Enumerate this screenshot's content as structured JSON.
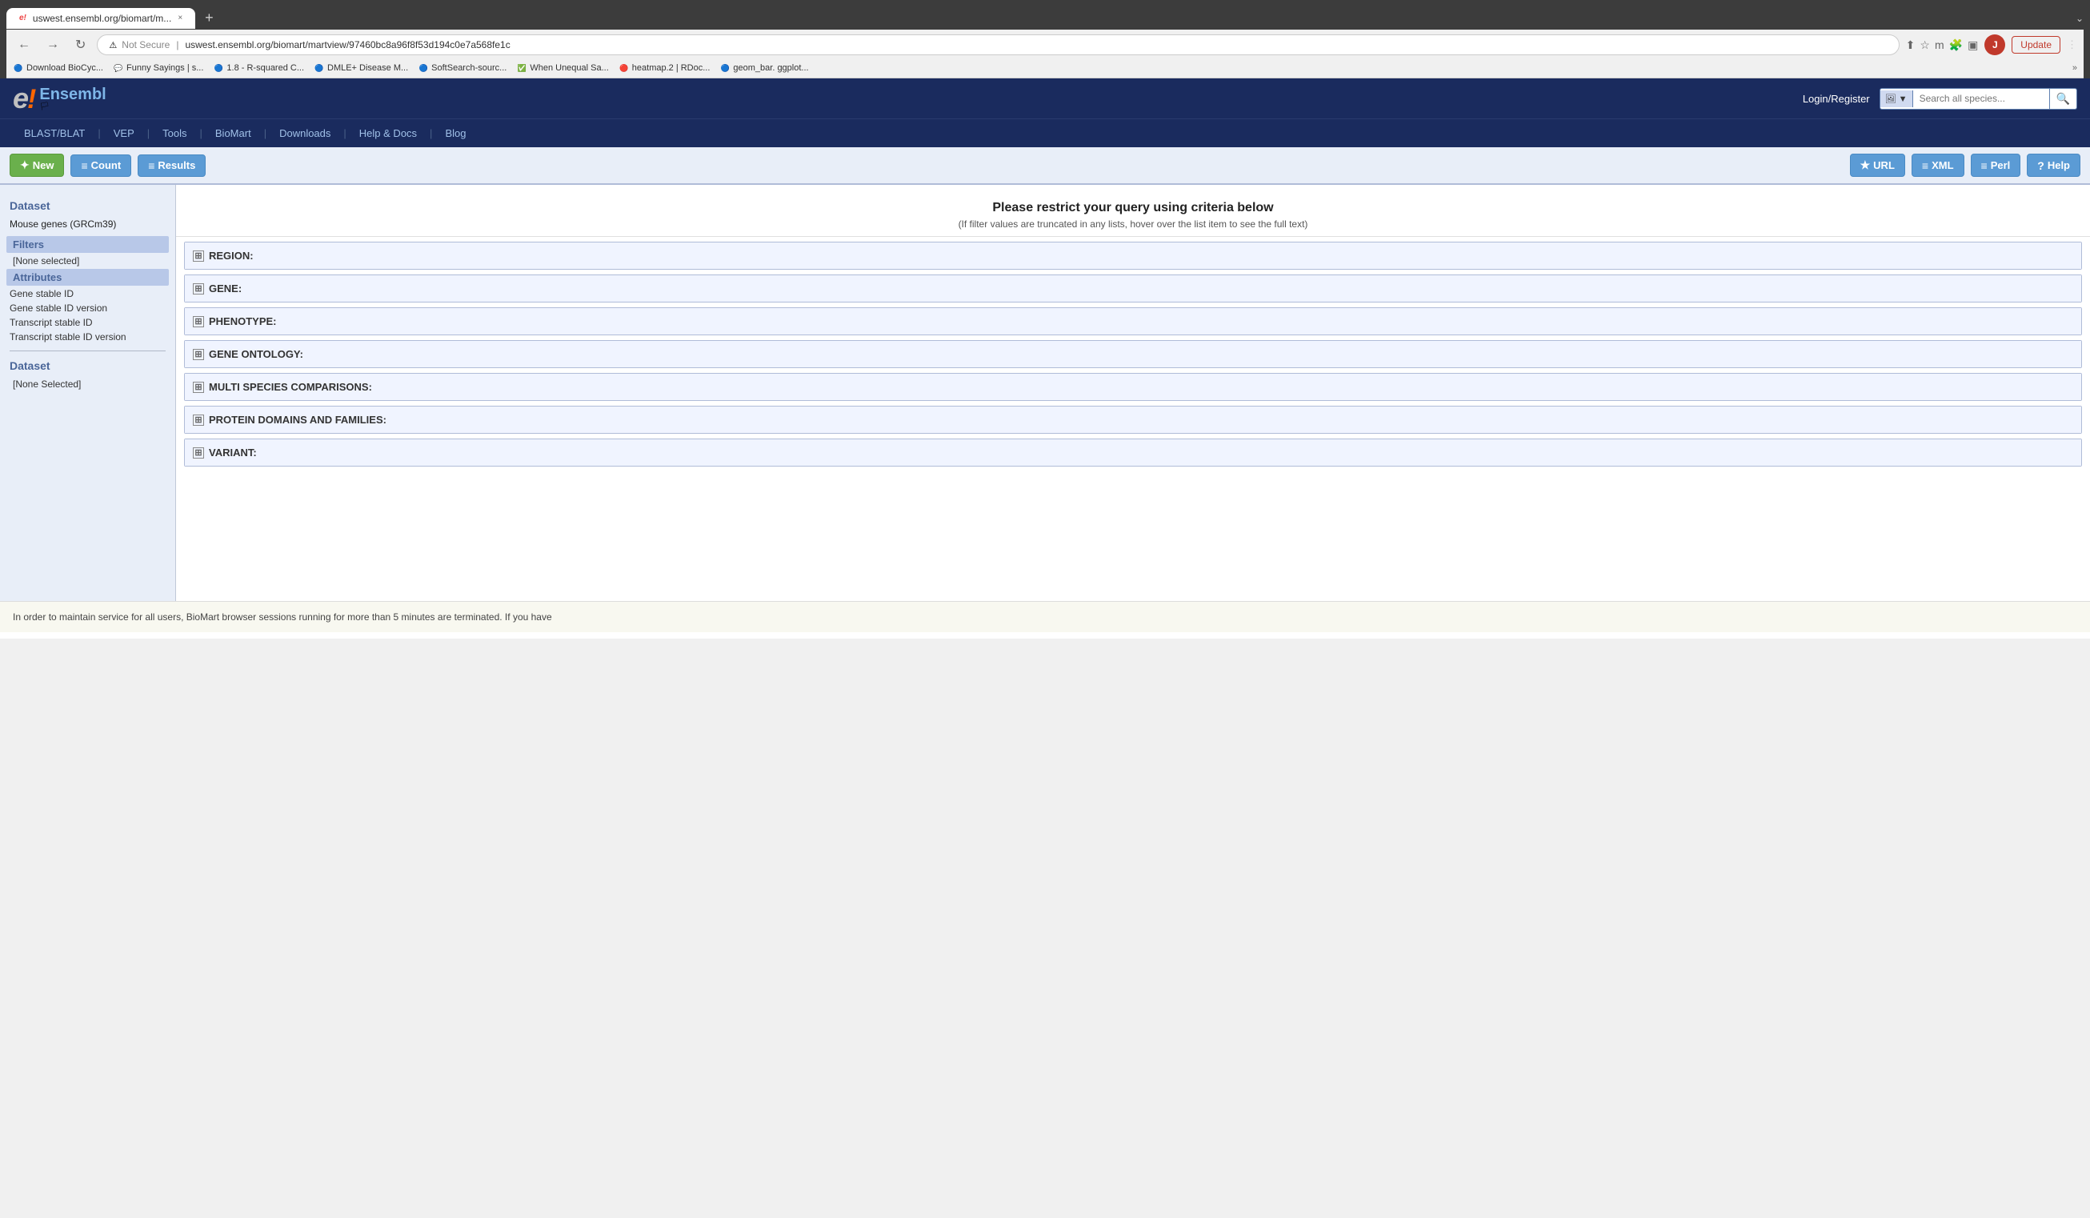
{
  "browser": {
    "tab": {
      "favicon": "e!",
      "title": "uswest.ensembl.org/biomart/m...",
      "close": "×"
    },
    "new_tab_icon": "+",
    "tab_end_icon": "⌄",
    "nav": {
      "back": "←",
      "forward": "→",
      "refresh": "↻"
    },
    "address": {
      "not_secure": "Not Secure",
      "url": "uswest.ensembl.org/biomart/martview/97460bc8a96f8f53d194c0e7a568fe1c"
    },
    "actions": {
      "share": "⬆",
      "star": "☆",
      "m_icon": "m",
      "puzzle": "🧩",
      "sidebar": "▣",
      "update_label": "Update",
      "menu": "⋮"
    },
    "bookmarks": [
      {
        "favicon": "🔵",
        "label": "Download BioCyc..."
      },
      {
        "favicon": "💬",
        "label": "Funny Sayings | s..."
      },
      {
        "favicon": "🔵",
        "label": "1.8 - R-squared C..."
      },
      {
        "favicon": "🔵",
        "label": "DMLE+ Disease M..."
      },
      {
        "favicon": "🔵",
        "label": "SoftSearch-sourc..."
      },
      {
        "favicon": "✅",
        "label": "When Unequal Sa..."
      },
      {
        "favicon": "🔴",
        "label": "heatmap.2 | RDoc..."
      },
      {
        "favicon": "🔵",
        "label": "geom_bar. ggplot..."
      },
      {
        "favicon": "»",
        "label": ""
      }
    ]
  },
  "header": {
    "logo": {
      "e_letter": "e",
      "exclaim": "!",
      "name": "Ensembl",
      "flag": "🏳"
    },
    "login": "Login/Register",
    "search_placeholder": "Search all species...",
    "nav_links": [
      "BLAST/BLAT",
      "VEP",
      "Tools",
      "BioMart",
      "Downloads",
      "Help & Docs",
      "Blog"
    ],
    "nav_separators": [
      "|",
      "|",
      "|",
      "|",
      "|",
      "|"
    ]
  },
  "toolbar": {
    "new_label": "New",
    "count_label": "Count",
    "results_label": "Results",
    "url_label": "URL",
    "xml_label": "XML",
    "perl_label": "Perl",
    "help_label": "Help",
    "new_icon": "✦",
    "count_icon": "≡",
    "results_icon": "≡",
    "url_icon": "★",
    "xml_icon": "≡",
    "perl_icon": "≡",
    "help_icon": "?"
  },
  "sidebar": {
    "dataset_label": "Dataset",
    "dataset_name": "Mouse genes (GRCm39)",
    "filters_label": "Filters",
    "filters_none": "[None selected]",
    "attributes_label": "Attributes",
    "attribute_items": [
      "Gene stable ID",
      "Gene stable ID version",
      "Transcript stable ID",
      "Transcript stable ID version"
    ],
    "dataset2_label": "Dataset",
    "dataset2_none": "[None Selected]"
  },
  "filter_panel": {
    "title": "Please restrict your query using criteria below",
    "subtitle": "(If filter values are truncated in any lists, hover over the list item to see the full text)",
    "sections": [
      {
        "label": "REGION:"
      },
      {
        "label": "GENE:"
      },
      {
        "label": "PHENOTYPE:"
      },
      {
        "label": "GENE ONTOLOGY:"
      },
      {
        "label": "MULTI SPECIES COMPARISONS:"
      },
      {
        "label": "PROTEIN DOMAINS AND FAMILIES:"
      },
      {
        "label": "VARIANT:"
      }
    ]
  },
  "bottom_notice": "In order to maintain service for all users, BioMart browser sessions running for more than 5 minutes are terminated. If you have",
  "avatar_letter": "J"
}
